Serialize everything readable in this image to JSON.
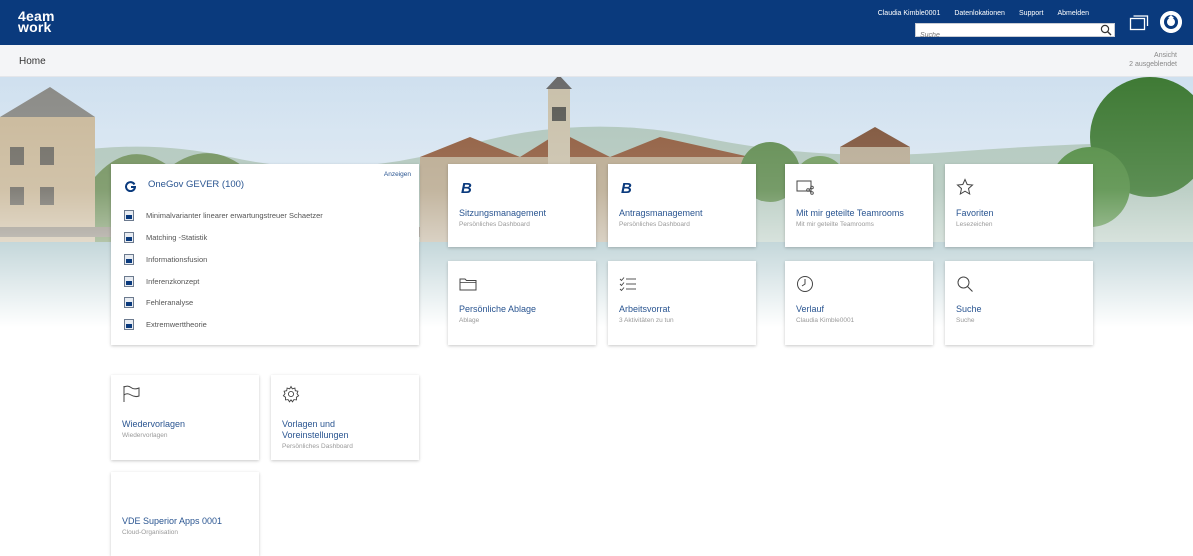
{
  "header": {
    "logo_line1": "4eam",
    "logo_line2": "work",
    "nav": [
      "Claudia Kimble0001",
      "Datenlokationen",
      "Support",
      "Abmelden"
    ],
    "search_placeholder": "Suche"
  },
  "breadcrumb": {
    "home": "Home",
    "view_label": "Ansicht",
    "view_hidden": "2 ausgeblendet"
  },
  "gever": {
    "title": "OneGov GEVER (100)",
    "show_label": "Anzeigen",
    "items": [
      "Minimalvarianter linearer erwartungstreuer Schaetzer",
      "Matching -Statistik",
      "Informationsfusion",
      "Inferenzkonzept",
      "Fehleranalyse",
      "Extremwerttheorie"
    ]
  },
  "tiles": {
    "sitzung": {
      "title": "Sitzungsmanagement",
      "sub": "Persönliches Dashboard",
      "icon": "b-logo-icon"
    },
    "antrag": {
      "title": "Antragsmanagement",
      "sub": "Persönliches Dashboard",
      "icon": "b-logo-icon"
    },
    "teamrooms": {
      "title": "Mit mir geteilte Teamrooms",
      "sub": "Mit mir geteilte Teamrooms",
      "icon": "shared-screen-icon"
    },
    "favoriten": {
      "title": "Favoriten",
      "sub": "Lesezeichen",
      "icon": "star-icon"
    },
    "ablage": {
      "title": "Persönliche Ablage",
      "sub": "Ablage",
      "icon": "folder-icon"
    },
    "arbeitsvorrat": {
      "title": "Arbeitsvorrat",
      "sub": "3 Aktivitäten zu tun",
      "icon": "checklist-icon"
    },
    "verlauf": {
      "title": "Verlauf",
      "sub": "Claudia Kimble0001",
      "icon": "clock-icon"
    },
    "suche": {
      "title": "Suche",
      "sub": "Suche",
      "icon": "search-icon"
    },
    "wiedervorlagen": {
      "title": "Wiedervorlagen",
      "sub": "Wiedervorlagen",
      "icon": "flag-icon"
    },
    "vorlagen": {
      "title_line1": "Vorlagen und",
      "title_line2": "Voreinstellungen",
      "sub": "Persönliches Dashboard",
      "icon": "gear-icon"
    },
    "vde": {
      "title": "VDE Superior Apps 0001",
      "sub": "Cloud-Organisation"
    }
  },
  "colors": {
    "header_bg": "#0a3a7d",
    "link": "#2a5591",
    "muted": "#9a9a9a"
  }
}
